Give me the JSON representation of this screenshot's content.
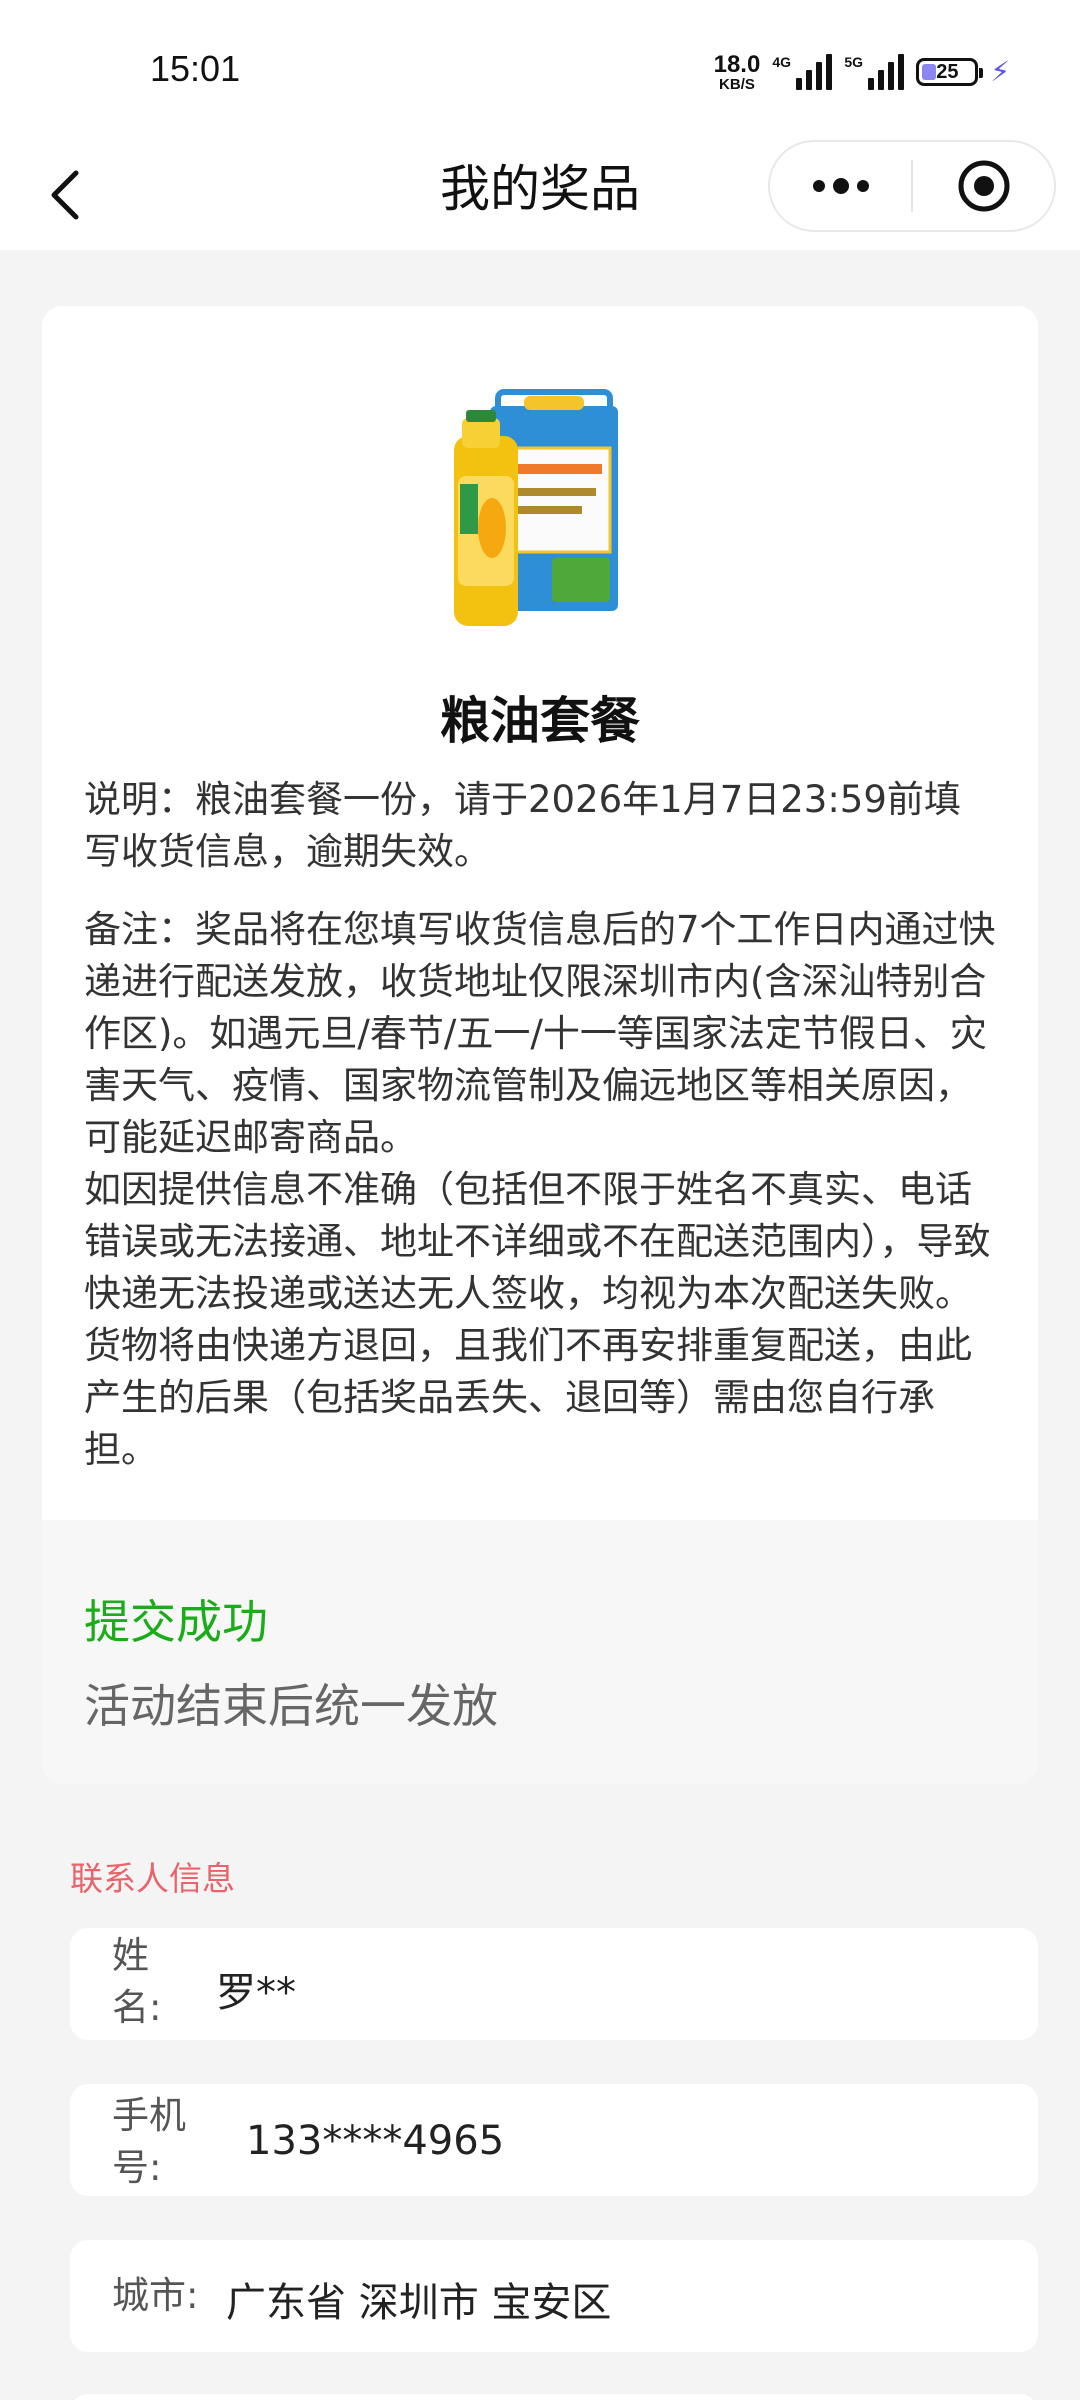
{
  "status_bar": {
    "time": "15:01",
    "net_speed_value": "18.0",
    "net_speed_unit": "KB/S",
    "signal1_label": "4G",
    "signal2_label": "5G",
    "battery_level": "25",
    "charging_icon": "bolt-icon"
  },
  "nav": {
    "title": "我的奖品",
    "back_icon": "chevron-left-icon",
    "more_icon": "more-dots-icon",
    "close_icon": "target-circle-icon"
  },
  "prize": {
    "image": "grain-oil-package",
    "name": "粮油套餐",
    "description": "说明：粮油套餐一份，请于2026年1月7日23:59前填写收货信息，逾期失效。",
    "remark": "备注：奖品将在您填写收货信息后的7个工作日内通过快递进行配送发放，收货地址仅限深圳市内(含深汕特别合作区)。如遇元旦/春节/五一/十一等国家法定节假日、灾害天气、疫情、国家物流管制及偏远地区等相关原因，可能延迟邮寄商品。\n如因提供信息不准确（包括但不限于姓名不真实、电话错误或无法接通、地址不详细或不在配送范围内），导致快递无法投递或送达无人签收，均视为本次配送失败。货物将由快递方退回，且我们不再安排重复配送，由此产生的后果（包括奖品丢失、退回等）需由您自行承担。",
    "status_title": "提交成功",
    "status_subtitle": "活动结束后统一发放",
    "status_color": "#1aad19"
  },
  "contact": {
    "heading": "联系人信息",
    "heading_color": "#e8646a",
    "name_label_line1": "姓",
    "name_label_line2": "名:",
    "name_value": "罗**",
    "phone_label_line1": "手机",
    "phone_label_line2": "号:",
    "phone_value": "133****4965",
    "city_label": "城市:",
    "city_value": "广东省 深圳市 宝安区"
  }
}
